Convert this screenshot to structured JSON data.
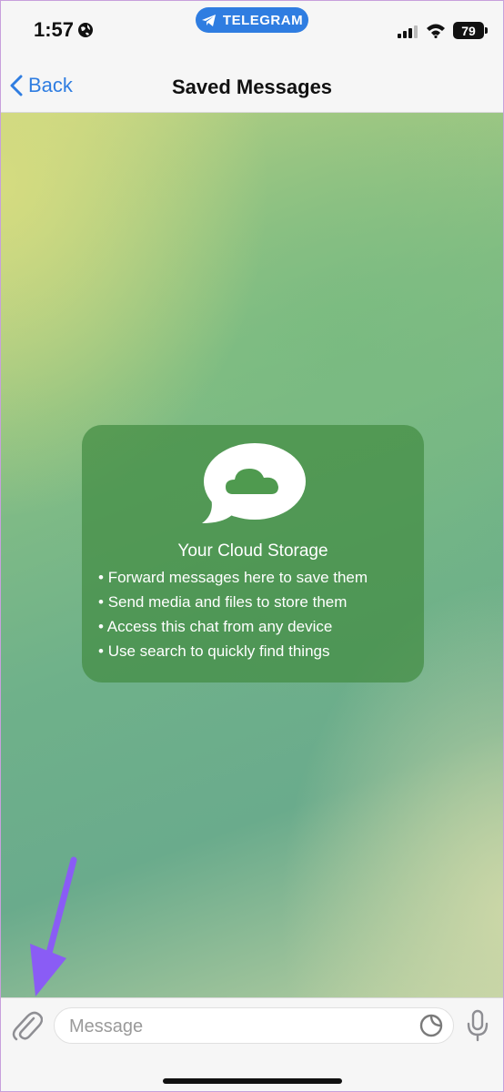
{
  "status_bar": {
    "time": "1:57",
    "app_pill": "TELEGRAM",
    "battery": "79"
  },
  "nav": {
    "back_label": "Back",
    "title": "Saved Messages"
  },
  "card": {
    "title": "Your Cloud Storage",
    "items": [
      "Forward messages here to save them",
      "Send media and files to store them",
      "Access this chat from any device",
      "Use search to quickly find things"
    ]
  },
  "input_bar": {
    "placeholder": "Message"
  },
  "colors": {
    "accent": "#2f7de1",
    "annotation_arrow": "#8a5cf5",
    "card_bg": "#428c42"
  },
  "icons": [
    "globe-icon",
    "telegram-icon",
    "signal-icon",
    "wifi-icon",
    "chevron-left-icon",
    "speech-bubble-cloud-icon",
    "paperclip-icon",
    "sticker-icon",
    "microphone-icon"
  ]
}
